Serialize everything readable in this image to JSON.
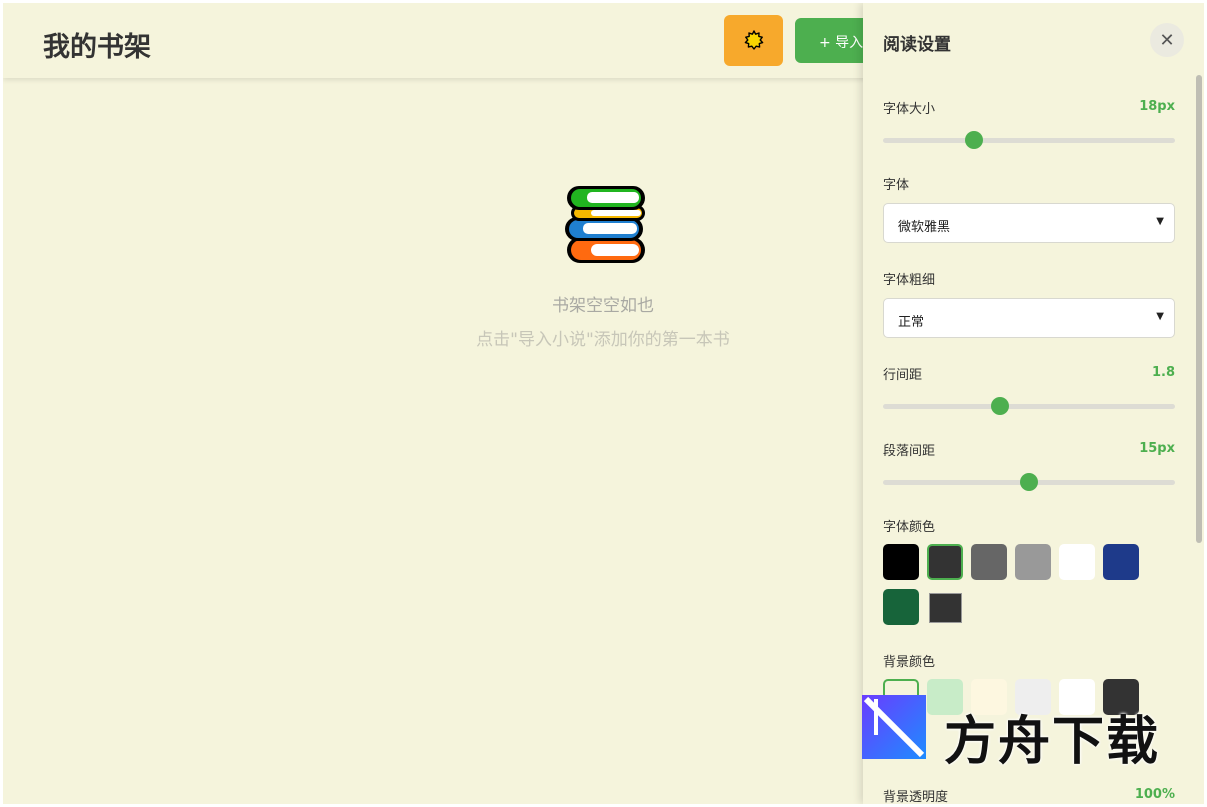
{
  "header": {
    "title": "我的书架",
    "theme_icon": "sun-icon",
    "import_label": "+ 导入小说"
  },
  "empty_state": {
    "icon": "books-icon",
    "title": "书架空空如也",
    "hint": "点击\"导入小说\"添加你的第一本书"
  },
  "settings": {
    "title": "阅读设置",
    "close_icon": "close-icon",
    "font_size": {
      "label": "字体大小",
      "value_text": "18px",
      "level": 0.31
    },
    "font_family": {
      "label": "字体",
      "selected": "微软雅黑"
    },
    "font_weight": {
      "label": "字体粗细",
      "selected": "正常"
    },
    "line_height": {
      "label": "行间距",
      "value_text": "1.8",
      "level": 0.4
    },
    "paragraph_spacing": {
      "label": "段落间距",
      "value_text": "15px",
      "level": 0.5
    },
    "font_color": {
      "label": "字体颜色",
      "colors": [
        "#000000",
        "#333333",
        "#666666",
        "#999999",
        "#ffffff",
        "#1e3a8a",
        "#17643a"
      ],
      "selected_index": 1,
      "custom_color": "#333333"
    },
    "bg_color": {
      "label": "背景颜色",
      "colors": [
        "#f5f4dc",
        "#c8ecc8",
        "#fdf7e0",
        "#eeeeee",
        "#ffffff",
        "#333333"
      ],
      "selected_index": 0
    },
    "bg_opacity": {
      "label": "背景透明度",
      "value_text": "100%"
    }
  },
  "watermark": {
    "text": "方舟下载"
  },
  "colors": {
    "accent": "#4daf4f",
    "orange": "#f7a92c",
    "background": "#f5f4dc"
  }
}
